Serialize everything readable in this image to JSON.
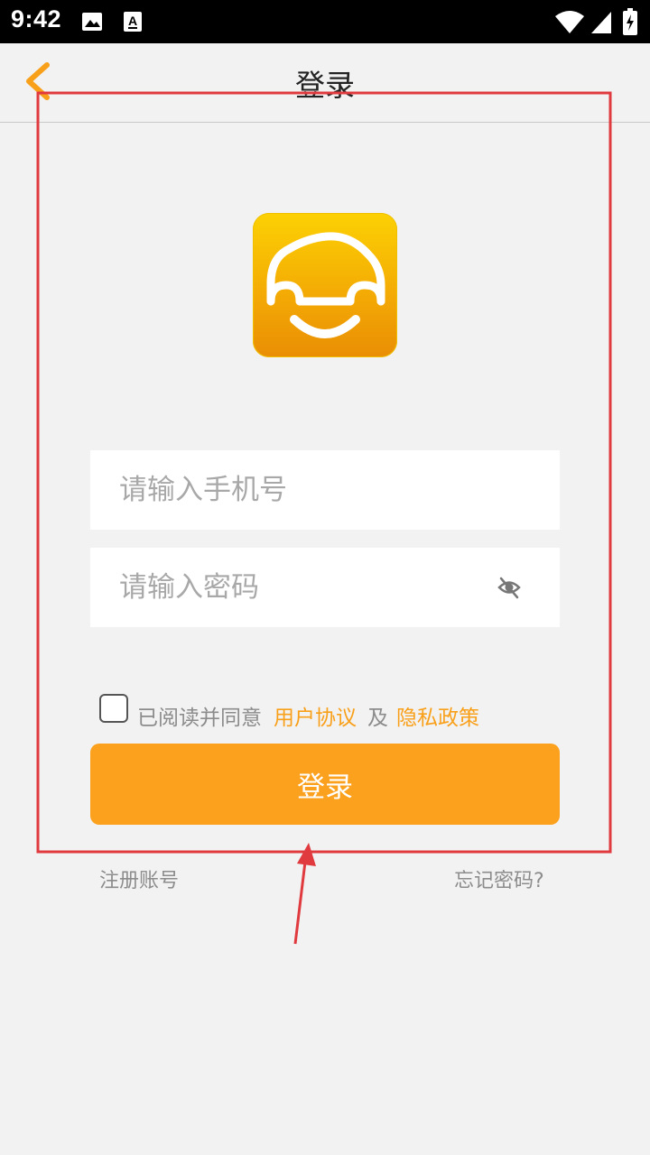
{
  "status_bar": {
    "time": "9:42",
    "icons": [
      "image-icon",
      "font-icon",
      "wifi-icon",
      "signal-icon",
      "battery-icon"
    ]
  },
  "header": {
    "title": "登录",
    "back_icon": "chevron-left-icon"
  },
  "form": {
    "phone_placeholder": "请输入手机号",
    "phone_value": "",
    "password_placeholder": "请输入密码",
    "password_value": "",
    "password_visibility_icon": "eye-off-icon"
  },
  "agreement": {
    "checked": false,
    "prefix": "已阅读并同意",
    "user_agreement": "用户协议",
    "conjunction": "及",
    "privacy_policy": "隐私政策"
  },
  "login_button": "登录",
  "footer": {
    "register": "注册账号",
    "forgot": "忘记密码?"
  },
  "colors": {
    "accent": "#fca11e",
    "link": "#f9a01b",
    "annotation": "#e0393e",
    "background": "#f2f2f2"
  }
}
